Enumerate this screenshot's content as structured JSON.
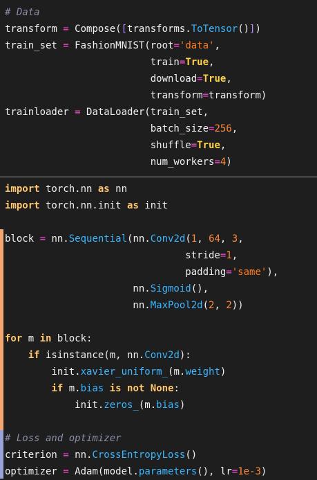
{
  "colors": {
    "background": "#1e1e1e",
    "comment": "#8a8fa6",
    "keyword": "#ffc66d",
    "call": "#3bb6ff",
    "operator": "#ff4fd8",
    "number": "#ff8a3a",
    "string": "#ff7a1a",
    "boolean": "#ffd24a",
    "bracket": "#b18cff",
    "text": "#f0f0f0",
    "gutter_orange": "#f2a672",
    "gutter_blue": "#9aa4d8"
  },
  "panels": [
    {
      "name": "data-loading-panel",
      "lines": [
        [
          {
            "t": "comment",
            "v": "# Data"
          }
        ],
        [
          {
            "t": "text",
            "v": "transform "
          },
          {
            "t": "op",
            "v": "="
          },
          {
            "t": "text",
            "v": " Compose("
          },
          {
            "t": "brk",
            "v": "["
          },
          {
            "t": "text",
            "v": "transforms."
          },
          {
            "t": "call",
            "v": "ToTensor"
          },
          {
            "t": "text",
            "v": "()"
          },
          {
            "t": "brk",
            "v": "]"
          },
          {
            "t": "text",
            "v": ")"
          }
        ],
        [
          {
            "t": "text",
            "v": "train_set "
          },
          {
            "t": "op",
            "v": "="
          },
          {
            "t": "text",
            "v": " FashionMNIST(root"
          },
          {
            "t": "op",
            "v": "="
          },
          {
            "t": "str",
            "v": "'data'"
          },
          {
            "t": "text",
            "v": ","
          }
        ],
        [
          {
            "t": "text",
            "v": "                         train"
          },
          {
            "t": "op",
            "v": "="
          },
          {
            "t": "bool",
            "v": "True"
          },
          {
            "t": "text",
            "v": ","
          }
        ],
        [
          {
            "t": "text",
            "v": "                         download"
          },
          {
            "t": "op",
            "v": "="
          },
          {
            "t": "bool",
            "v": "True"
          },
          {
            "t": "text",
            "v": ","
          }
        ],
        [
          {
            "t": "text",
            "v": "                         transform"
          },
          {
            "t": "op",
            "v": "="
          },
          {
            "t": "text",
            "v": "transform)"
          }
        ],
        [
          {
            "t": "text",
            "v": "trainloader "
          },
          {
            "t": "op",
            "v": "="
          },
          {
            "t": "text",
            "v": " DataLoader(train_set,"
          }
        ],
        [
          {
            "t": "text",
            "v": "                         batch_size"
          },
          {
            "t": "op",
            "v": "="
          },
          {
            "t": "num",
            "v": "256"
          },
          {
            "t": "text",
            "v": ","
          }
        ],
        [
          {
            "t": "text",
            "v": "                         shuffle"
          },
          {
            "t": "op",
            "v": "="
          },
          {
            "t": "bool",
            "v": "True"
          },
          {
            "t": "text",
            "v": ","
          }
        ],
        [
          {
            "t": "text",
            "v": "                         num_workers"
          },
          {
            "t": "op",
            "v": "="
          },
          {
            "t": "num",
            "v": "4"
          },
          {
            "t": "text",
            "v": ")"
          }
        ]
      ]
    },
    {
      "name": "model-panel",
      "lines": [
        [
          {
            "t": "kw",
            "v": "import"
          },
          {
            "t": "text",
            "v": " torch.nn "
          },
          {
            "t": "kw",
            "v": "as"
          },
          {
            "t": "text",
            "v": " nn"
          }
        ],
        [
          {
            "t": "kw",
            "v": "import"
          },
          {
            "t": "text",
            "v": " torch.nn.init "
          },
          {
            "t": "kw",
            "v": "as"
          },
          {
            "t": "text",
            "v": " init"
          }
        ],
        [],
        [
          {
            "t": "text",
            "v": "block "
          },
          {
            "t": "op",
            "v": "="
          },
          {
            "t": "text",
            "v": " nn."
          },
          {
            "t": "call",
            "v": "Sequential"
          },
          {
            "t": "text",
            "v": "(nn."
          },
          {
            "t": "call",
            "v": "Conv2d"
          },
          {
            "t": "text",
            "v": "("
          },
          {
            "t": "num",
            "v": "1"
          },
          {
            "t": "text",
            "v": ", "
          },
          {
            "t": "num",
            "v": "64"
          },
          {
            "t": "text",
            "v": ", "
          },
          {
            "t": "num",
            "v": "3"
          },
          {
            "t": "text",
            "v": ","
          }
        ],
        [
          {
            "t": "text",
            "v": "                               stride"
          },
          {
            "t": "op",
            "v": "="
          },
          {
            "t": "num",
            "v": "1"
          },
          {
            "t": "text",
            "v": ","
          }
        ],
        [
          {
            "t": "text",
            "v": "                               padding"
          },
          {
            "t": "op",
            "v": "="
          },
          {
            "t": "str",
            "v": "'same'"
          },
          {
            "t": "text",
            "v": "),"
          }
        ],
        [
          {
            "t": "text",
            "v": "                      nn."
          },
          {
            "t": "call",
            "v": "Sigmoid"
          },
          {
            "t": "text",
            "v": "(),"
          }
        ],
        [
          {
            "t": "text",
            "v": "                      nn."
          },
          {
            "t": "call",
            "v": "MaxPool2d"
          },
          {
            "t": "text",
            "v": "("
          },
          {
            "t": "num",
            "v": "2"
          },
          {
            "t": "text",
            "v": ", "
          },
          {
            "t": "num",
            "v": "2"
          },
          {
            "t": "text",
            "v": "))"
          }
        ],
        [],
        [
          {
            "t": "kw",
            "v": "for"
          },
          {
            "t": "text",
            "v": " m "
          },
          {
            "t": "kw",
            "v": "in"
          },
          {
            "t": "text",
            "v": " block:"
          }
        ],
        [
          {
            "t": "text",
            "v": "    "
          },
          {
            "t": "kw",
            "v": "if"
          },
          {
            "t": "text",
            "v": " isinstance(m, nn."
          },
          {
            "t": "call",
            "v": "Conv2d"
          },
          {
            "t": "text",
            "v": "):"
          }
        ],
        [
          {
            "t": "text",
            "v": "        init."
          },
          {
            "t": "call",
            "v": "xavier_uniform_"
          },
          {
            "t": "text",
            "v": "(m."
          },
          {
            "t": "call",
            "v": "weight"
          },
          {
            "t": "text",
            "v": ")"
          }
        ],
        [
          {
            "t": "text",
            "v": "        "
          },
          {
            "t": "kw",
            "v": "if"
          },
          {
            "t": "text",
            "v": " m."
          },
          {
            "t": "call",
            "v": "bias"
          },
          {
            "t": "text",
            "v": " "
          },
          {
            "t": "kw",
            "v": "is"
          },
          {
            "t": "text",
            "v": " "
          },
          {
            "t": "kw",
            "v": "not"
          },
          {
            "t": "text",
            "v": " "
          },
          {
            "t": "kw",
            "v": "None"
          },
          {
            "t": "text",
            "v": ":"
          }
        ],
        [
          {
            "t": "text",
            "v": "            init."
          },
          {
            "t": "call",
            "v": "zeros_"
          },
          {
            "t": "text",
            "v": "(m."
          },
          {
            "t": "call",
            "v": "bias"
          },
          {
            "t": "text",
            "v": ")"
          }
        ],
        [],
        [
          {
            "t": "comment",
            "v": "# Loss and optimizer"
          }
        ],
        [
          {
            "t": "text",
            "v": "criterion "
          },
          {
            "t": "op",
            "v": "="
          },
          {
            "t": "text",
            "v": " nn."
          },
          {
            "t": "call",
            "v": "CrossEntropyLoss"
          },
          {
            "t": "text",
            "v": "()"
          }
        ],
        [
          {
            "t": "text",
            "v": "optimizer "
          },
          {
            "t": "op",
            "v": "="
          },
          {
            "t": "text",
            "v": " Adam(model."
          },
          {
            "t": "call",
            "v": "parameters"
          },
          {
            "t": "text",
            "v": "(), lr"
          },
          {
            "t": "op",
            "v": "="
          },
          {
            "t": "num",
            "v": "1e-3"
          },
          {
            "t": "text",
            "v": ")"
          }
        ]
      ]
    }
  ]
}
